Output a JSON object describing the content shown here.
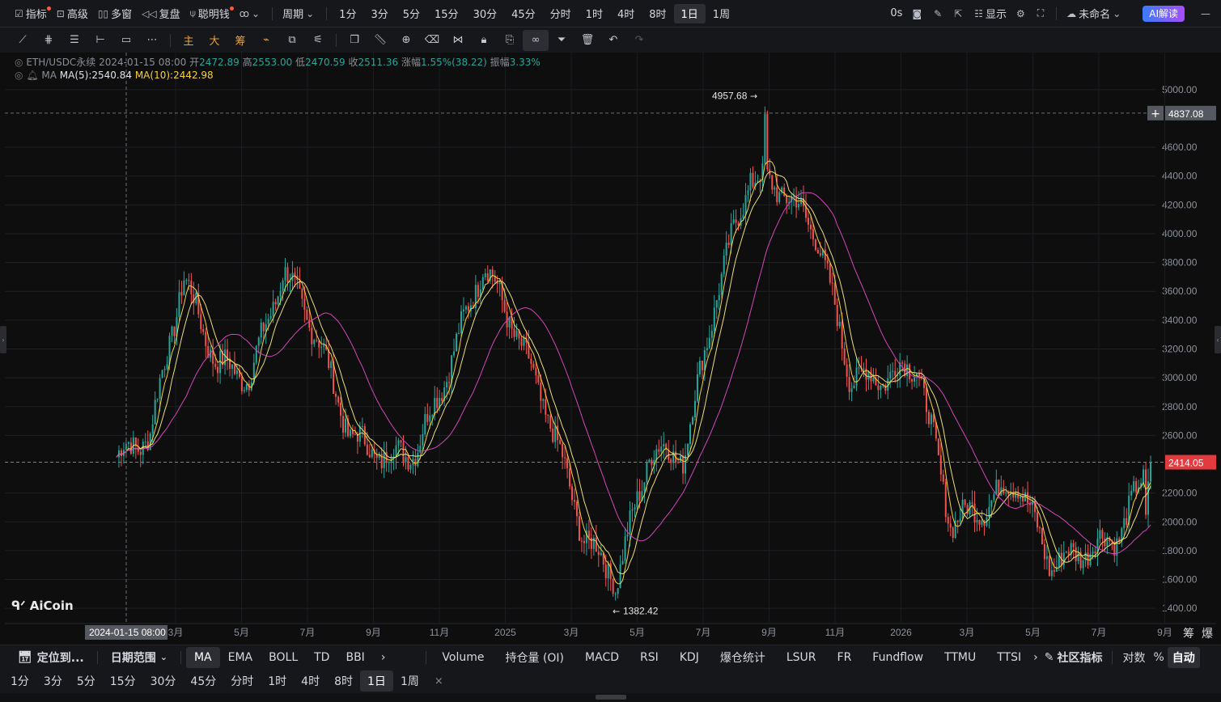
{
  "toolbar": {
    "indicator": "指标",
    "advanced": "高级",
    "multi_window": "多窗",
    "replay": "复盘",
    "smart_money": "聪明钱",
    "period_menu": "周期",
    "periods": [
      "1分",
      "3分",
      "5分",
      "15分",
      "30分",
      "45分",
      "分时",
      "1时",
      "4时",
      "8时",
      "1日",
      "1周"
    ],
    "active_period": "1日",
    "delay": "0s",
    "display": "显示",
    "account": "未命名",
    "ai_button": "AI解读"
  },
  "drawing_tools": {
    "main": "主",
    "big": "大",
    "chips": "筹"
  },
  "legend": {
    "symbol": "ETH/USDC永续",
    "datetime": "2024-01-15 08:00",
    "open_label": "开",
    "open": "2472.89",
    "high_label": "高",
    "high": "2553.00",
    "low_label": "低",
    "low": "2470.59",
    "close_label": "收",
    "close": "2511.36",
    "change_label": "涨幅",
    "change": "1.55%(38.22)",
    "amp_label": "振幅",
    "amp": "3.33%",
    "ma_name": "MA",
    "ma5": "MA(5):2540.84",
    "ma10": "MA(10):2442.98"
  },
  "price_axis": {
    "ticks": [
      "5000.00",
      "4600.00",
      "4400.00",
      "4200.00",
      "4000.00",
      "3800.00",
      "3600.00",
      "3400.00",
      "3200.00",
      "3000.00",
      "2800.00",
      "2600.00",
      "2200.00",
      "2000.00",
      "1800.00",
      "1600.00",
      "1400.00"
    ],
    "crosshair_price": "4837.08",
    "last_price": "2414.05",
    "max_label": "4957.68",
    "min_label": "1382.42"
  },
  "time_axis": {
    "ticks": [
      "3月",
      "5月",
      "7月",
      "9月",
      "11月",
      "2025",
      "3月",
      "5月",
      "7月",
      "9月",
      "11月",
      "2026",
      "3月",
      "5月",
      "7月",
      "9月"
    ],
    "crosshair_time": "2024-01-15 08:00",
    "right_buttons": [
      "筹",
      "爆"
    ]
  },
  "logo": "AiCoin",
  "bottom_bar": {
    "locate": "定位到...",
    "date_range": "日期范围",
    "main_indicators": [
      "MA",
      "EMA",
      "BOLL",
      "TD",
      "BBI"
    ],
    "sub_indicators": [
      "Volume",
      "持仓量 (OI)",
      "MACD",
      "RSI",
      "KDJ",
      "爆仓统计",
      "LSUR",
      "FR",
      "Fundflow",
      "TTMU",
      "TTSI"
    ],
    "community": "社区指标",
    "log": "对数",
    "percent": "%",
    "auto": "自动"
  },
  "period_bar": [
    "1分",
    "3分",
    "5分",
    "15分",
    "30分",
    "45分",
    "分时",
    "1时",
    "4时",
    "8时",
    "1日",
    "1周"
  ],
  "period_bar_active": "1日",
  "colors": {
    "up": "#26a69a",
    "down": "#ef5350",
    "ma5": "#f3d23b",
    "ma10": "#e9e07a",
    "ma30": "#d147b8"
  },
  "chart_data": {
    "type": "candlestick",
    "symbol": "ETH/USDC永续",
    "interval": "1日",
    "x": [
      "2024-01",
      "2024-02",
      "2024-03",
      "2024-04",
      "2024-05",
      "2024-06",
      "2024-07",
      "2024-08",
      "2024-09",
      "2024-10",
      "2024-11",
      "2024-12",
      "2025-01",
      "2025-02",
      "2025-03",
      "2025-04",
      "2025-05",
      "2025-06",
      "2025-07",
      "2025-08",
      "2025-09",
      "2025-10",
      "2025-11",
      "2025-12",
      "2026-01",
      "2026-02",
      "2026-03",
      "2026-04",
      "2026-05",
      "2026-06",
      "2026-07",
      "2026-08"
    ],
    "close_approx": [
      2450,
      2600,
      3700,
      3100,
      3000,
      3750,
      3300,
      2600,
      2450,
      2500,
      3100,
      3800,
      3300,
      2700,
      1900,
      1600,
      2500,
      2450,
      3600,
      4400,
      4300,
      4000,
      3000,
      3000,
      3100,
      2000,
      2100,
      2300,
      1700,
      1800,
      1900,
      2414
    ],
    "ylim": [
      1300,
      5100
    ],
    "max": 4957.68,
    "min": 1382.42,
    "last": 2414.05
  }
}
